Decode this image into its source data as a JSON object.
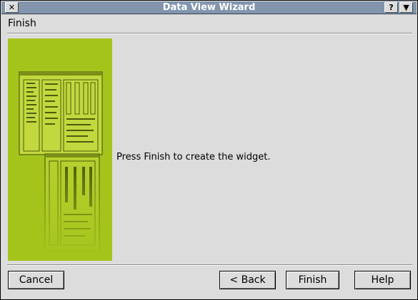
{
  "window": {
    "title": "Data View Wizard",
    "close_glyph": "✕",
    "help_glyph": "?",
    "menu_glyph": "▼",
    "titlebar_color": "#7d93ad"
  },
  "page": {
    "title": "Finish",
    "message": "Press Finish to create the widget."
  },
  "illustration": {
    "icon": "wizard-windows-illustration",
    "background_color": "#a4c41c"
  },
  "buttons": {
    "cancel": "Cancel",
    "back": "< Back",
    "finish": "Finish",
    "help": "Help"
  }
}
